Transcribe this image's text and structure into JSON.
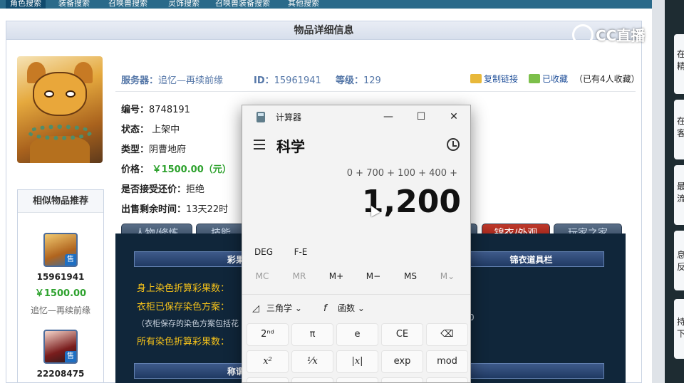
{
  "topnav": [
    "角色搜索",
    "装备搜索",
    "召唤兽搜索",
    "灵饰搜索",
    "召唤兽装备搜索",
    "其他搜索"
  ],
  "panel": {
    "title": "物品详细信息"
  },
  "item": {
    "server_label": "服务器：",
    "server": "追忆—再续前缘",
    "id_label": "ID：",
    "id": "15961941",
    "level_label": "等级：",
    "level": "129",
    "copy_link": "复制链接",
    "favorited": "已收藏",
    "favorite_count_text": "（已有4人收藏）",
    "rows": [
      {
        "key": "编号：",
        "value": "8748191"
      },
      {
        "key": "状态：",
        "value": " 上架中"
      },
      {
        "key": "类型：",
        "value": "阴曹地府"
      },
      {
        "key": "价格：",
        "value": " ￥1500.00（元）"
      },
      {
        "key": "是否接受还价：",
        "value": "拒绝"
      },
      {
        "key": "出售剩余时间：",
        "value": "13天22时"
      }
    ]
  },
  "similar": {
    "title": "相似物品推荐",
    "items": [
      {
        "id": "15961941",
        "price": "￥1500.00",
        "server": "追忆—再续前缘",
        "badge": "售"
      },
      {
        "id": "22208475",
        "badge": "售"
      }
    ]
  },
  "tabs": [
    "人物/修炼",
    "技能",
    "锦衣/外观",
    "玩家之家"
  ],
  "dark": {
    "bar1_left": "彩果",
    "bar1_right": "锦衣道具栏",
    "bar2": "称谓",
    "label1": "身上染色折算彩果数：",
    "label2": "衣柜已保存染色方案：",
    "note": "（衣柜保存的染色方案包括花",
    "label3": "所有染色折算彩果数：",
    "stray": "0"
  },
  "right_panel": [
    "在精",
    "在客",
    "最流",
    "息反",
    "持下"
  ],
  "watermark": "CC直播",
  "calculator": {
    "app_title": "计算器",
    "minimize": "—",
    "maximize": "☐",
    "close": "✕",
    "mode": "科学",
    "expression": "0 + 700 + 100 + 400 +",
    "display": "1,200",
    "angle_keys": [
      "DEG",
      "F-E"
    ],
    "memory_keys": [
      "MC",
      "MR",
      "M+",
      "M−",
      "MS",
      "M⌄"
    ],
    "trig_label": "三角学",
    "func_label": "函数",
    "key_rows": [
      [
        "2ⁿᵈ",
        "π",
        "e",
        "CE",
        "⌫"
      ],
      [
        "x²",
        "¹⁄x",
        "|x|",
        "exp",
        "mod"
      ]
    ]
  },
  "colors": {
    "price": "#2ea22e",
    "accent_tab": "#c0392b",
    "link": "#23529b"
  }
}
